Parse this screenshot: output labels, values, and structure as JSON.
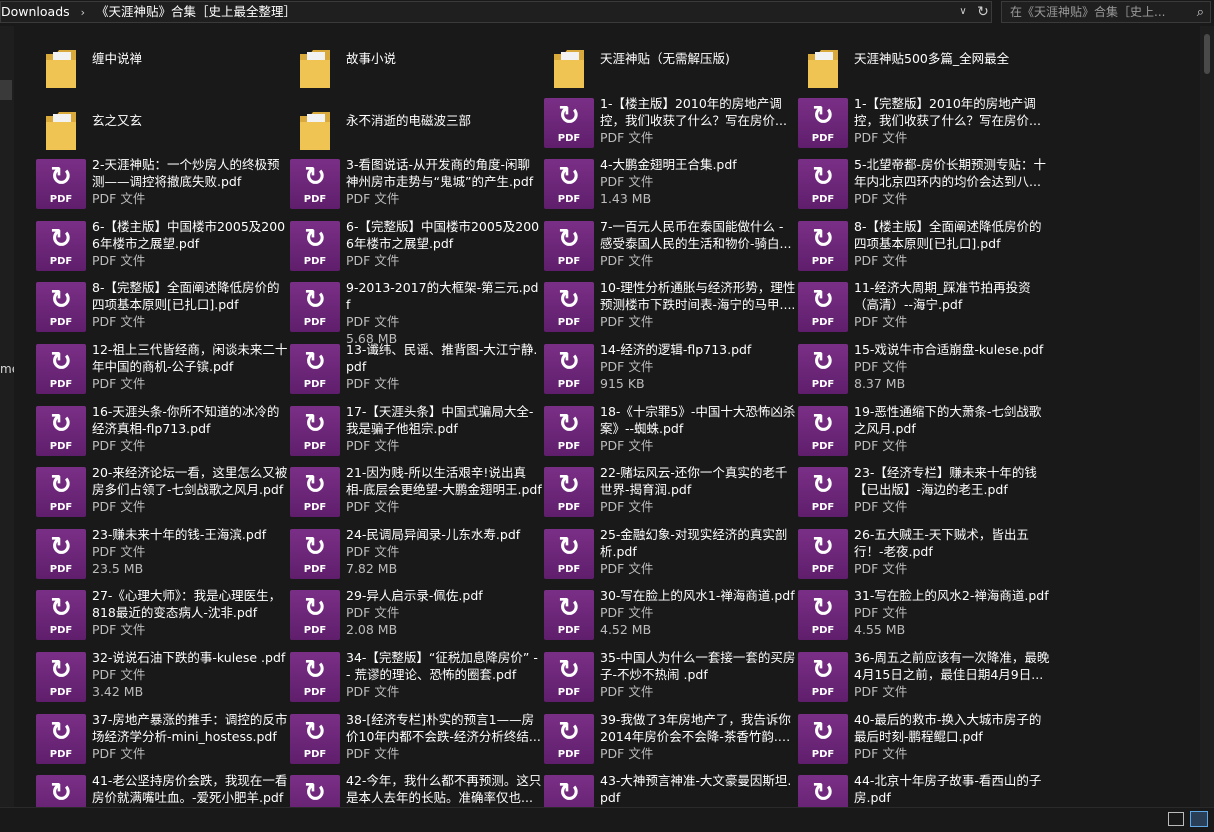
{
  "address": {
    "crumbs": [
      "Downloads",
      "《天涯神贴》合集［史上最全整理］"
    ],
    "search_placeholder": "在《天涯神贴》合集［史上..."
  },
  "nav": {
    "partial_label": "me"
  },
  "items": [
    {
      "type": "folder",
      "name": "缠中说禅"
    },
    {
      "type": "folder",
      "name": "故事小说"
    },
    {
      "type": "folder",
      "name": "天涯神贴（无需解压版)"
    },
    {
      "type": "folder",
      "name": "天涯神贴500多篇_全网最全"
    },
    {
      "type": "folder",
      "name": "玄之又玄"
    },
    {
      "type": "folder",
      "name": "永不消逝的电磁波三部"
    },
    {
      "type": "pdf",
      "name": "1-【楼主版】2010年的房地产调控，我们收获了什么？写在房价...",
      "kind": "PDF 文件",
      "size": ""
    },
    {
      "type": "pdf",
      "name": "1-【完整版】2010年的房地产调控，我们收获了什么？写在房价...",
      "kind": "PDF 文件",
      "size": ""
    },
    {
      "type": "pdf",
      "name": "2-天涯神贴：一个炒房人的终极预测——调控将撤底失败.pdf",
      "kind": "PDF 文件",
      "size": ""
    },
    {
      "type": "pdf",
      "name": "3-看图说话-从开发商的角度-闲聊神州房市走势与“鬼城”的产生.pdf",
      "kind": "PDF 文件",
      "size": ""
    },
    {
      "type": "pdf",
      "name": "4-大鹏金翅明王合集.pdf",
      "kind": "PDF 文件",
      "size": "1.43 MB"
    },
    {
      "type": "pdf",
      "name": "5-北望帝都-房价长期预测专贴：十年内北京四环内的均价会达到八...",
      "kind": "PDF 文件",
      "size": ""
    },
    {
      "type": "pdf",
      "name": "6-【楼主版】中国楼市2005及2006年楼市之展望.pdf",
      "kind": "PDF 文件",
      "size": ""
    },
    {
      "type": "pdf",
      "name": "6-【完整版】中国楼市2005及2006年楼市之展望.pdf",
      "kind": "PDF 文件",
      "size": ""
    },
    {
      "type": "pdf",
      "name": "7-一百元人民币在泰国能做什么 - 感受泰国人民的生活和物价-骑白...",
      "kind": "PDF 文件",
      "size": ""
    },
    {
      "type": "pdf",
      "name": "8-【楼主版】全面阐述降低房价的四项基本原则[已扎口].pdf",
      "kind": "PDF 文件",
      "size": ""
    },
    {
      "type": "pdf",
      "name": "8-【完整版】全面阐述降低房价的四项基本原则[已扎口].pdf",
      "kind": "PDF 文件",
      "size": ""
    },
    {
      "type": "pdf",
      "name": "9-2013-2017的大框架-第三元.pdf",
      "kind": "PDF 文件",
      "size": "5.68 MB"
    },
    {
      "type": "pdf",
      "name": "10-理性分析通胀与经济形势，理性预测楼市下跌时间表-海宁的马甲....",
      "kind": "PDF 文件",
      "size": ""
    },
    {
      "type": "pdf",
      "name": "11-经济大周期_踩准节拍再投资（高清）--海宁.pdf",
      "kind": "PDF 文件",
      "size": ""
    },
    {
      "type": "pdf",
      "name": "12-祖上三代皆经商，闲谈未来二十年中国的商机-公子镔.pdf",
      "kind": "PDF 文件",
      "size": ""
    },
    {
      "type": "pdf",
      "name": "13-谶纬、民谣、推背图-大江宁静.pdf",
      "kind": "PDF 文件",
      "size": ""
    },
    {
      "type": "pdf",
      "name": "14-经济的逻辑-flp713.pdf",
      "kind": "PDF 文件",
      "size": "915 KB"
    },
    {
      "type": "pdf",
      "name": "15-戏说牛市合适崩盘-kulese.pdf",
      "kind": "PDF 文件",
      "size": "8.37 MB"
    },
    {
      "type": "pdf",
      "name": "16-天涯头条-你所不知道的冰冷的经济真相-flp713.pdf",
      "kind": "PDF 文件",
      "size": ""
    },
    {
      "type": "pdf",
      "name": "17-【天涯头条】中国式骗局大全-我是骗子他祖宗.pdf",
      "kind": "PDF 文件",
      "size": ""
    },
    {
      "type": "pdf",
      "name": "18-《十宗罪5》-中国十大恐怖凶杀案》--蜘蛛.pdf",
      "kind": "PDF 文件",
      "size": ""
    },
    {
      "type": "pdf",
      "name": "19-恶性通缩下的大萧条-七剑战歌之风月.pdf",
      "kind": "PDF 文件",
      "size": ""
    },
    {
      "type": "pdf",
      "name": "20-来经济论坛一看，这里怎么又被房多们占领了-七剑战歌之风月.pdf",
      "kind": "PDF 文件",
      "size": ""
    },
    {
      "type": "pdf",
      "name": "21-因为贱-所以生活艰辛!说出真相-底层会更绝望-大鹏金翅明王.pdf",
      "kind": "PDF 文件",
      "size": ""
    },
    {
      "type": "pdf",
      "name": "22-赌坛风云-还你一个真实的老千世界-揭育润.pdf",
      "kind": "PDF 文件",
      "size": ""
    },
    {
      "type": "pdf",
      "name": "23-【经济专栏】赚未来十年的钱【已出版】-海边的老王.pdf",
      "kind": "PDF 文件",
      "size": ""
    },
    {
      "type": "pdf",
      "name": "23-赚未来十年的钱-王海滨.pdf",
      "kind": "PDF 文件",
      "size": "23.5 MB"
    },
    {
      "type": "pdf",
      "name": "24-民调局异闻录-儿东水寿.pdf",
      "kind": "PDF 文件",
      "size": "7.82 MB"
    },
    {
      "type": "pdf",
      "name": "25-金融幻象-对现实经济的真实剖析.pdf",
      "kind": "PDF 文件",
      "size": ""
    },
    {
      "type": "pdf",
      "name": "26-五大贼王-天下贼术，皆出五行！-老夜.pdf",
      "kind": "PDF 文件",
      "size": ""
    },
    {
      "type": "pdf",
      "name": "27-《心理大师》：我是心理医生，818最近的变态病人-沈非.pdf",
      "kind": "PDF 文件",
      "size": ""
    },
    {
      "type": "pdf",
      "name": "29-异人启示录-佩佐.pdf",
      "kind": "PDF 文件",
      "size": "2.08 MB"
    },
    {
      "type": "pdf",
      "name": "30-写在脸上的风水1-禅海商道.pdf",
      "kind": "PDF 文件",
      "size": "4.52 MB"
    },
    {
      "type": "pdf",
      "name": "31-写在脸上的风水2-禅海商道.pdf",
      "kind": "PDF 文件",
      "size": "4.55 MB"
    },
    {
      "type": "pdf",
      "name": "32-说说石油下跌的事-kulese .pdf",
      "kind": "PDF 文件",
      "size": "3.42 MB"
    },
    {
      "type": "pdf",
      "name": "34-【完整版】“征税加息降房价” - - 荒谬的理论、恐怖的圈套.pdf",
      "kind": "PDF 文件",
      "size": ""
    },
    {
      "type": "pdf",
      "name": "35-中国人为什么一套接一套的买房子-不炒不热闹 .pdf",
      "kind": "PDF 文件",
      "size": ""
    },
    {
      "type": "pdf",
      "name": "36-周五之前应该有一次降准，最晚4月15日之前，最佳日期4月9日...",
      "kind": "PDF 文件",
      "size": ""
    },
    {
      "type": "pdf",
      "name": "37-房地产暴涨的推手：调控的反市场经济学分析-mini_hostess.pdf",
      "kind": "PDF 文件",
      "size": ""
    },
    {
      "type": "pdf",
      "name": "38-[经济专栏]朴实的预言1——房价10年内都不会跌-经济分析终结...",
      "kind": "PDF 文件",
      "size": ""
    },
    {
      "type": "pdf",
      "name": "39-我做了3年房地产了，我告诉你2014年房价会不会降-茶香竹韵.p...",
      "kind": "PDF 文件",
      "size": ""
    },
    {
      "type": "pdf",
      "name": "40-最后的救市-换入大城市房子的最后时刻-鹏程鲲口.pdf",
      "kind": "PDF 文件",
      "size": ""
    },
    {
      "type": "pdf",
      "name": "41-老公坚持房价会跌，我现在一看房价就满嘴吐血。-爱死小肥羊.pdf",
      "kind": "PDF 文件",
      "size": ""
    },
    {
      "type": "pdf",
      "name": "42-今年，我什么都不再预测。这只是本人去年的长贴。准确率仅也...",
      "kind": "PDF 文件",
      "size": ""
    },
    {
      "type": "pdf",
      "name": "43-大神预言神准-大文豪曼因斯坦.pdf",
      "kind": "PDF 文件",
      "size": ""
    },
    {
      "type": "pdf",
      "name": "44-北京十年房子故事-看西山的子房.pdf",
      "kind": "PDF 文件",
      "size": ""
    }
  ]
}
